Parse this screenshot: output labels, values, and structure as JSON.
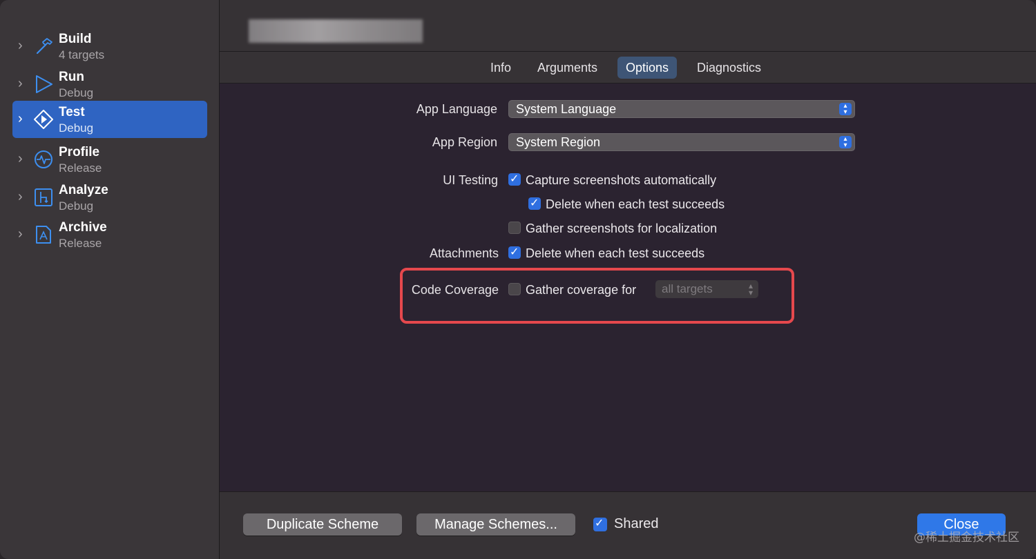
{
  "sidebar": {
    "items": [
      {
        "title": "Build",
        "subtitle": "4 targets",
        "icon": "hammer-icon"
      },
      {
        "title": "Run",
        "subtitle": "Debug",
        "icon": "play-icon"
      },
      {
        "title": "Test",
        "subtitle": "Debug",
        "icon": "test-diamond-icon"
      },
      {
        "title": "Profile",
        "subtitle": "Release",
        "icon": "gauge-icon"
      },
      {
        "title": "Analyze",
        "subtitle": "Debug",
        "icon": "analyze-icon"
      },
      {
        "title": "Archive",
        "subtitle": "Release",
        "icon": "archive-icon"
      }
    ],
    "selected_index": 2
  },
  "tabs": [
    "Info",
    "Arguments",
    "Options",
    "Diagnostics"
  ],
  "active_tab": "Options",
  "options": {
    "app_language": {
      "label": "App Language",
      "value": "System Language"
    },
    "app_region": {
      "label": "App Region",
      "value": "System Region"
    },
    "ui_testing": {
      "label": "UI Testing",
      "capture": {
        "text": "Capture screenshots automatically",
        "checked": true
      },
      "delete": {
        "text": "Delete when each test succeeds",
        "checked": true
      },
      "gather": {
        "text": "Gather screenshots for localization",
        "checked": false
      }
    },
    "attachments": {
      "label": "Attachments",
      "delete": {
        "text": "Delete when each test succeeds",
        "checked": true
      }
    },
    "code_coverage": {
      "label": "Code Coverage",
      "gather": {
        "text": "Gather coverage for",
        "checked": false
      },
      "targets": "all targets"
    }
  },
  "footer": {
    "duplicate": "Duplicate Scheme",
    "manage": "Manage Schemes...",
    "shared": {
      "text": "Shared",
      "checked": true
    },
    "close": "Close"
  },
  "watermark": "@稀土掘金技术社区",
  "colors": {
    "accent": "#2f6fe0",
    "highlight": "#e5484d",
    "selected": "#2f64c2"
  }
}
